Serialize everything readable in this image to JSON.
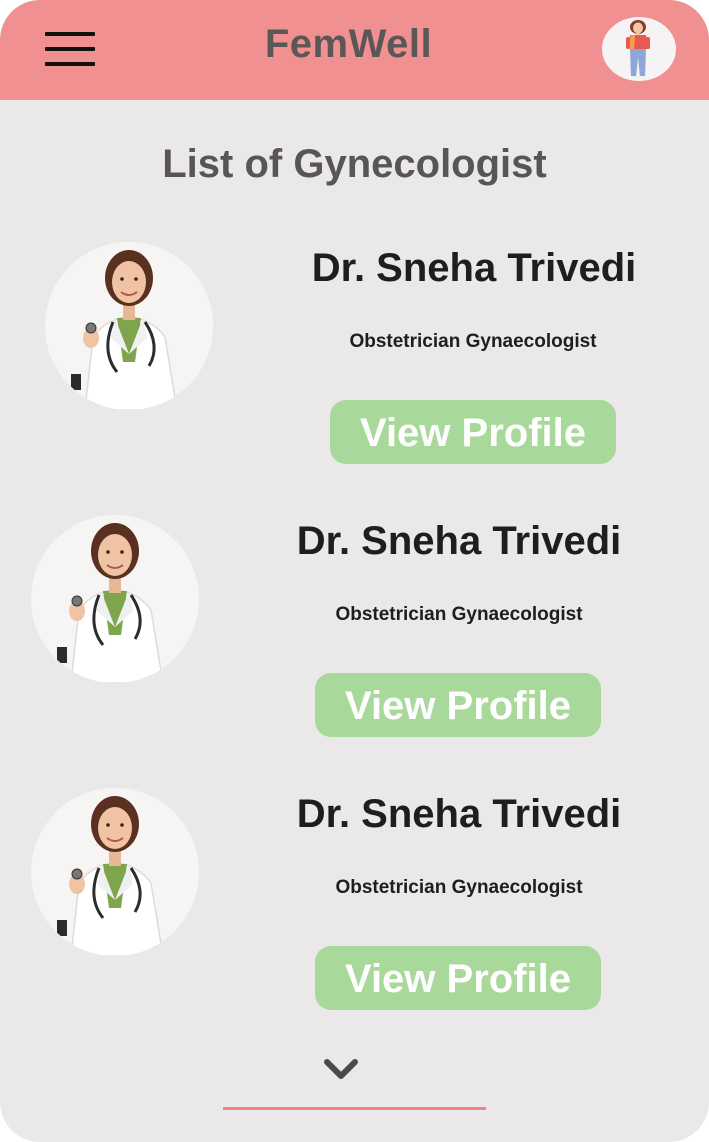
{
  "header": {
    "app_title": "FemWell",
    "menu_icon": "hamburger-menu-icon",
    "user_avatar_icon": "user-avatar-illustration"
  },
  "main": {
    "title": "List of Gynecologist",
    "doctors": [
      {
        "name": "Dr. Sneha Trivedi",
        "specialty": "Obstetrician Gynaecologist",
        "button_label": "View Profile"
      },
      {
        "name": "Dr. Sneha Trivedi",
        "specialty": "Obstetrician Gynaecologist",
        "button_label": "View Profile"
      },
      {
        "name": "Dr. Sneha Trivedi",
        "specialty": "Obstetrician Gynaecologist",
        "button_label": "View Profile"
      }
    ],
    "scroll_icon": "chevron-down-icon"
  },
  "colors": {
    "header_bg": "#f19090",
    "page_bg": "#ebe8e9",
    "button_bg": "#a9d99a",
    "button_text": "#ffffff",
    "title_text": "#585555",
    "accent_line": "#f08484"
  }
}
